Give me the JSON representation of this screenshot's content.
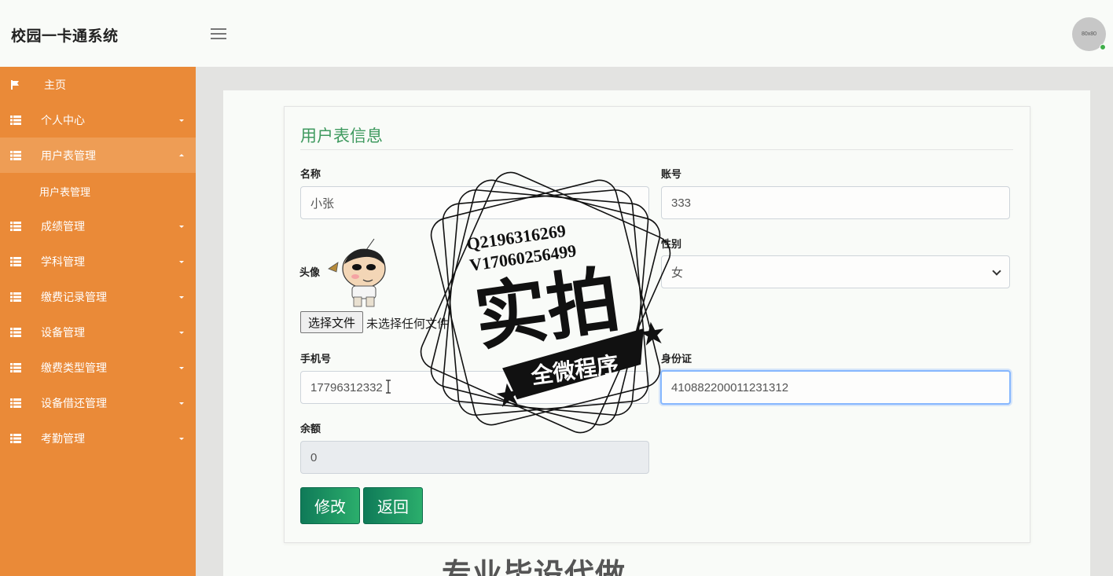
{
  "header": {
    "brand": "校园一卡通系统",
    "avatar_text": "80x80"
  },
  "sidebar": {
    "items": [
      {
        "label": "主页",
        "icon": "flag-icon"
      },
      {
        "label": "个人中心",
        "icon": "grid-icon"
      },
      {
        "label": "用户表管理",
        "icon": "grid-icon",
        "expanded": true
      },
      {
        "label": "成绩管理",
        "icon": "grid-icon"
      },
      {
        "label": "学科管理",
        "icon": "grid-icon"
      },
      {
        "label": "缴费记录管理",
        "icon": "grid-icon"
      },
      {
        "label": "设备管理",
        "icon": "grid-icon"
      },
      {
        "label": "缴费类型管理",
        "icon": "grid-icon"
      },
      {
        "label": "设备借还管理",
        "icon": "grid-icon"
      },
      {
        "label": "考勤管理",
        "icon": "grid-icon"
      }
    ],
    "sub_item": "用户表管理"
  },
  "form": {
    "title": "用户表信息",
    "name_label": "名称",
    "name_value": "小张",
    "account_label": "账号",
    "account_value": "333",
    "avatar_label": "头像",
    "gender_label": "性别",
    "gender_value": "女",
    "file_button": "选择文件",
    "file_status": "未选择任何文件",
    "phone_label": "手机号",
    "phone_value": "17796312332",
    "idcard_label": "身份证",
    "idcard_value": "410882200011231312",
    "balance_label": "余额",
    "balance_value": "0",
    "edit_button": "修改",
    "back_button": "返回"
  },
  "watermark": {
    "line1": "Q2196316269",
    "line2": "V17060256499",
    "main": "实拍",
    "banner": "全微程序",
    "bottom": "专业毕设代做"
  },
  "colors": {
    "sidebar_bg": "#ea8a38",
    "sidebar_active": "#ee9d55",
    "title_green": "#3f9a5f",
    "button_green": "#1a9463"
  }
}
